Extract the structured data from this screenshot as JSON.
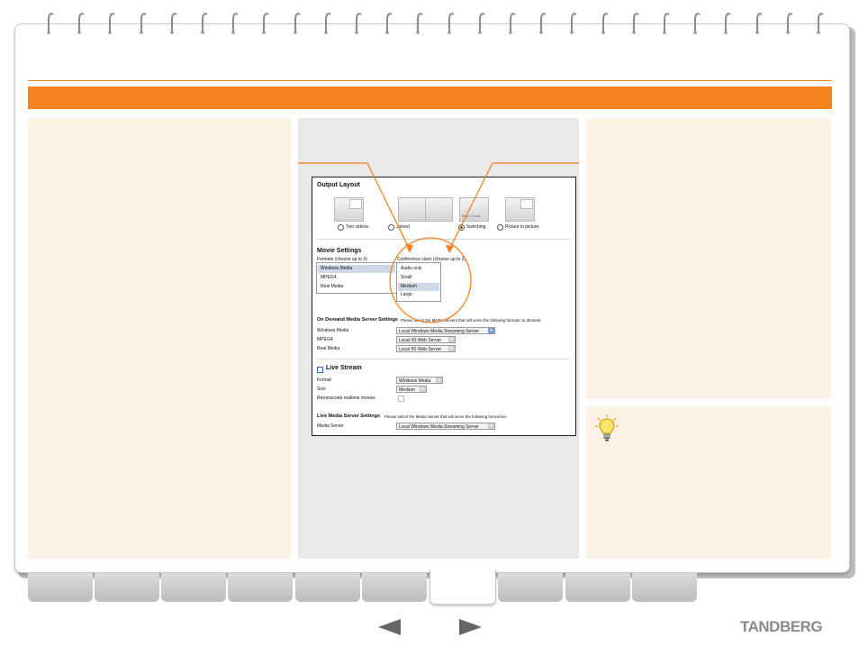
{
  "brand": {
    "logo_text": "TANDBERG"
  },
  "screen": {
    "output_layout": {
      "title": "Output Layout",
      "options": [
        {
          "label": "Two videos",
          "thumb_caption": "Main",
          "thumb_inset": "Video"
        },
        {
          "label": "Joined",
          "thumb_caption": "Main",
          "thumb_caption_2": "Video"
        },
        {
          "label": "Switching",
          "thumb_caption": "Main / Dual",
          "selected": true
        },
        {
          "label": "Picture in picture",
          "thumb_caption": "Main",
          "thumb_inset": "Video"
        }
      ]
    },
    "movie_settings": {
      "title": "Movie Settings",
      "formats_label": "Formats (choose up to 3)",
      "formats": [
        "Windows Media",
        "MPEG4",
        "Real Media"
      ],
      "formats_selected": "Windows Media",
      "sizes_label": "Conference sizes (choose up to 2)",
      "sizes": [
        "Audio only",
        "Small",
        "Medium",
        "Large"
      ],
      "sizes_selected": "Medium"
    },
    "on_demand": {
      "title": "On Demand Media Server Settings",
      "note": "Please select the Media Servers that will serve the following formats on demand",
      "rows": [
        {
          "label": "Windows Media",
          "value": "Local Windows Media Streaming Server"
        },
        {
          "label": "MPEG4",
          "value": "Local IIS Web Server"
        },
        {
          "label": "Real Media",
          "value": "Local IIS Web Server"
        }
      ]
    },
    "live_stream": {
      "title": "Live Stream",
      "format_label": "Format",
      "format_value": "Windows Media",
      "size_label": "Size",
      "size_value": "Medium",
      "retranscode_label": "Retranscode realtime movies"
    },
    "live_media": {
      "title": "Live Media Server Settings",
      "note": "Please select the Media Server that will serve the following format live",
      "server_label": "Media Server",
      "server_value": "Local Windows Media Streaming Server"
    }
  },
  "colors": {
    "accent": "#f5821f",
    "panel": "#fdf1e5",
    "screenshot_panel": "#e9e9e9",
    "tab": "#c8c8c8"
  },
  "icons": [
    "lightbulb-icon",
    "prev-arrow-icon",
    "next-arrow-icon",
    "spiral-binding-icon"
  ]
}
